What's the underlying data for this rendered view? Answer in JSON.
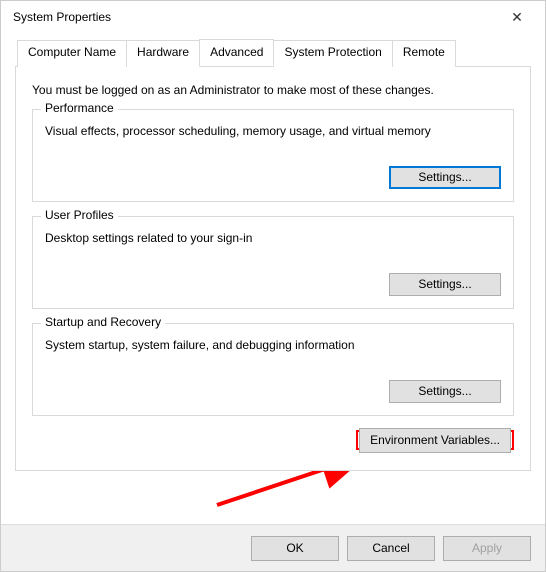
{
  "window": {
    "title": "System Properties"
  },
  "tabs": {
    "t0": "Computer Name",
    "t1": "Hardware",
    "t2": "Advanced",
    "t3": "System Protection",
    "t4": "Remote"
  },
  "intro": "You must be logged on as an Administrator to make most of these changes.",
  "groups": {
    "performance": {
      "legend": "Performance",
      "desc": "Visual effects, processor scheduling, memory usage, and virtual memory",
      "btn": "Settings..."
    },
    "userprofiles": {
      "legend": "User Profiles",
      "desc": "Desktop settings related to your sign-in",
      "btn": "Settings..."
    },
    "startup": {
      "legend": "Startup and Recovery",
      "desc": "System startup, system failure, and debugging information",
      "btn": "Settings..."
    }
  },
  "env_btn": "Environment Variables...",
  "buttons": {
    "ok": "OK",
    "cancel": "Cancel",
    "apply": "Apply"
  }
}
